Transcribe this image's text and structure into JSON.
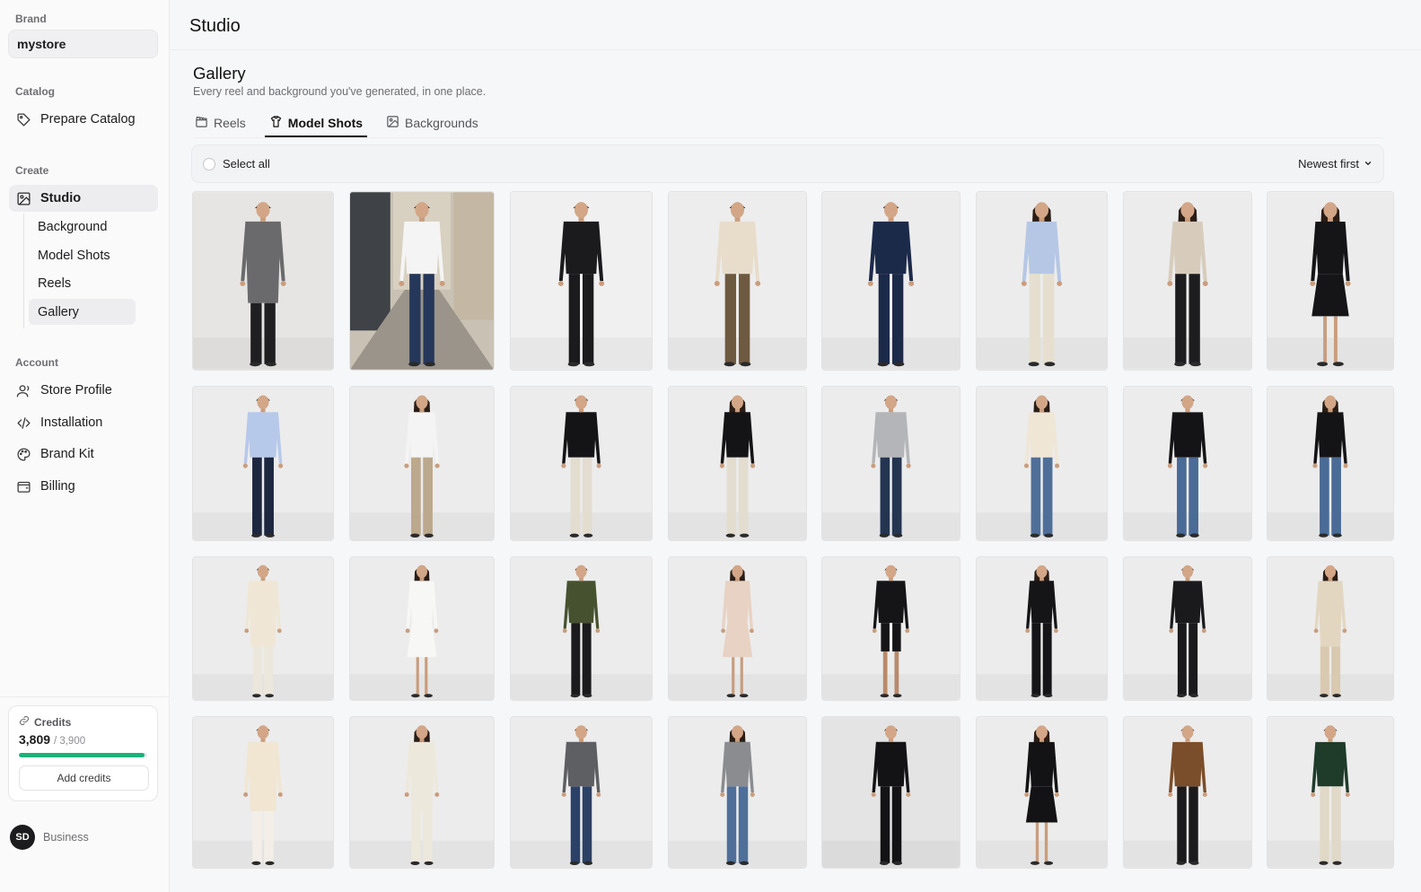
{
  "sidebar": {
    "brand_label": "Brand",
    "brand_value": "mystore",
    "catalog_label": "Catalog",
    "catalog_items": [
      {
        "label": "Prepare Catalog",
        "icon": "tag-icon"
      }
    ],
    "create_label": "Create",
    "studio_label": "Studio",
    "studio_sub": [
      {
        "label": "Background",
        "active": false
      },
      {
        "label": "Model Shots",
        "active": false
      },
      {
        "label": "Reels",
        "active": false
      },
      {
        "label": "Gallery",
        "active": true
      }
    ],
    "account_label": "Account",
    "account_items": [
      {
        "label": "Store Profile",
        "icon": "user-icon"
      },
      {
        "label": "Installation",
        "icon": "code-icon"
      },
      {
        "label": "Brand Kit",
        "icon": "palette-icon"
      },
      {
        "label": "Billing",
        "icon": "wallet-icon"
      }
    ],
    "credits": {
      "label": "Credits",
      "used": "3,809",
      "total": "/ 3,900",
      "fraction": 0.977,
      "button": "Add credits"
    },
    "user": {
      "initials": "SD",
      "plan": "Business"
    }
  },
  "topbar": {
    "title": "Studio"
  },
  "main": {
    "title": "Gallery",
    "subtitle": "Every reel and background you've generated, in one place.",
    "tabs": [
      {
        "label": "Reels",
        "icon": "clapper-icon",
        "active": false
      },
      {
        "label": "Model Shots",
        "icon": "shirt-icon",
        "active": true
      },
      {
        "label": "Backgrounds",
        "icon": "image-icon",
        "active": false
      }
    ],
    "select_all": "Select all",
    "sort": "Newest first"
  },
  "gallery": {
    "tiles": [
      {
        "g": "m",
        "top": "#6a6a6c",
        "bot": "#1f1f22",
        "long": true,
        "bg": "#e6e5e3"
      },
      {
        "g": "m",
        "top": "#f4f4f4",
        "bot": "#25375a",
        "bg": "street"
      },
      {
        "g": "m",
        "top": "#1b1b1d",
        "bot": "#1b1b1d",
        "bg": "#f0f0f0"
      },
      {
        "g": "m",
        "top": "#e8dccb",
        "bot": "#6e5a40",
        "bg": "#ededed"
      },
      {
        "g": "m",
        "top": "#1c2a4a",
        "bot": "#1c2a4a",
        "bg": "#ececec"
      },
      {
        "g": "f",
        "top": "#b6c7e6",
        "bot": "#e6dfcf",
        "bg": "#ececec"
      },
      {
        "g": "f",
        "top": "#d7ccbb",
        "bot": "#1d1d1f",
        "bg": "#ececec"
      },
      {
        "g": "f",
        "top": "#151517",
        "bot": "#151517",
        "dress": true,
        "bg": "#ececec"
      },
      {
        "g": "m",
        "top": "#b7c9ea",
        "bot": "#1e2740",
        "bg": "#ececec"
      },
      {
        "g": "f",
        "top": "#f4f4f4",
        "bot": "#bca88c",
        "bg": "#ececec"
      },
      {
        "g": "m",
        "top": "#141416",
        "bot": "#e3ddd0",
        "bg": "#ececec"
      },
      {
        "g": "f",
        "top": "#141416",
        "bot": "#e3ddd0",
        "bg": "#ececec"
      },
      {
        "g": "m",
        "top": "#b4b5b8",
        "bot": "#243552",
        "bg": "#ececec"
      },
      {
        "g": "f",
        "top": "#efe6d6",
        "bot": "#4f6f99",
        "bg": "#ececec"
      },
      {
        "g": "m",
        "top": "#141416",
        "bot": "#4a6b96",
        "bg": "#ececec"
      },
      {
        "g": "f",
        "top": "#141416",
        "bot": "#4a6b96",
        "bg": "#ececec"
      },
      {
        "g": "m",
        "top": "#efe6d5",
        "bot": "#ece7dc",
        "long": true,
        "bg": "#ececec"
      },
      {
        "g": "f",
        "top": "#f7f7f5",
        "bot": "#f7f7f5",
        "dress": true,
        "bg": "#ececec"
      },
      {
        "g": "m",
        "top": "#46522f",
        "bot": "#1b1b1d",
        "bg": "#ececec"
      },
      {
        "g": "f",
        "top": "#e7d2c3",
        "bot": "#e7d2c3",
        "dress": true,
        "bg": "#ececec"
      },
      {
        "g": "m",
        "top": "#151517",
        "bot": "#151517",
        "shorts": true,
        "bg": "#ececec"
      },
      {
        "g": "f",
        "top": "#151517",
        "bot": "#151517",
        "bg": "#ececec"
      },
      {
        "g": "m",
        "top": "#1a1a1c",
        "bot": "#1a1a1c",
        "bg": "#ececec"
      },
      {
        "g": "f",
        "top": "#e3d6c1",
        "bot": "#d9c9b0",
        "long": true,
        "bg": "#ececec"
      },
      {
        "g": "m",
        "top": "#f1e6d2",
        "bot": "#f3efe8",
        "long": true,
        "bg": "#ececec"
      },
      {
        "g": "f",
        "top": "#ede8dc",
        "bot": "#ede8dc",
        "long": true,
        "bg": "#ececec"
      },
      {
        "g": "m",
        "top": "#5e5f62",
        "bot": "#2c4166",
        "bg": "#ececec"
      },
      {
        "g": "f",
        "top": "#8a8c90",
        "bot": "#4f6f99",
        "bg": "#ececec"
      },
      {
        "g": "m",
        "top": "#131315",
        "bot": "#131315",
        "bg": "#e4e4e4"
      },
      {
        "g": "f",
        "top": "#131315",
        "bot": "#131315",
        "dress": true,
        "bg": "#ececec"
      },
      {
        "g": "m",
        "top": "#7a4e2a",
        "bot": "#1b1b1d",
        "bg": "#ececec"
      },
      {
        "g": "m",
        "top": "#1f3b2a",
        "bot": "#e1d9c8",
        "bg": "#ececec"
      }
    ]
  }
}
